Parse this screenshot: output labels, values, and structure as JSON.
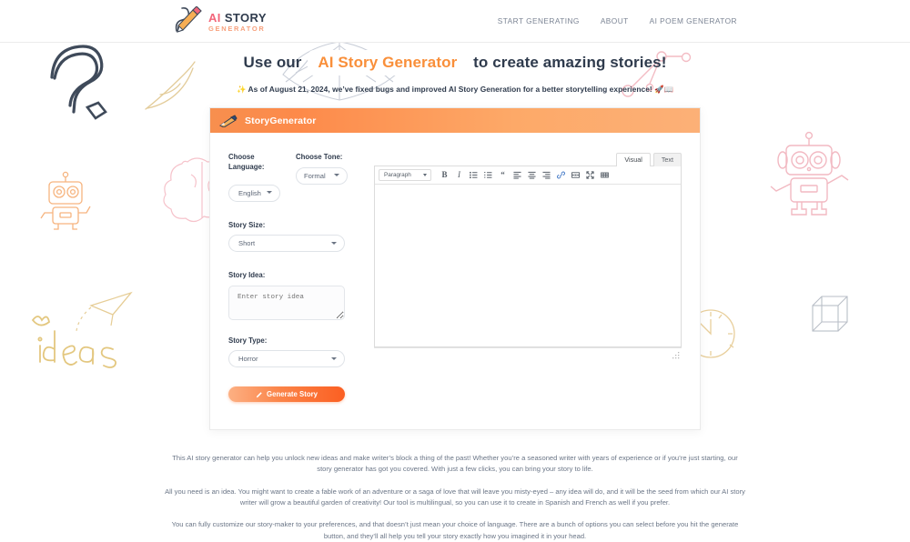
{
  "brand": {
    "logo_icon": "pencil-scribble-icon",
    "line1_ai": "AI",
    "line1_story": "STORY",
    "line2": "GENERATOR"
  },
  "nav": {
    "items": [
      {
        "label": "START GENERATING",
        "name": "nav-start-generating"
      },
      {
        "label": "ABOUT",
        "name": "nav-about"
      },
      {
        "label": "AI POEM GENERATOR",
        "name": "nav-ai-poem-generator"
      }
    ]
  },
  "hero": {
    "title_before": "Use our",
    "title_highlight": "AI Story Generator",
    "title_after": "to create amazing stories!",
    "note_spark": "✨",
    "note_text": "As of August 21, 2024, we’ve fixed bugs and improved AI Story Generation for a better storytelling experience!",
    "note_emoji": "🚀📖"
  },
  "card": {
    "header_icon": "quill-pen-icon",
    "title": "StoryGenerator",
    "form": {
      "language_label": "Choose Language:",
      "language_value": "English",
      "tone_label": "Choose Tone:",
      "tone_value": "Formal",
      "size_label": "Story Size:",
      "size_value": "Short",
      "idea_label": "Story Idea:",
      "idea_value": "",
      "idea_placeholder": "Enter story idea",
      "type_label": "Story Type:",
      "type_value": "Horror",
      "generate_label": "Generate Story",
      "generate_icon": "pencil-icon"
    },
    "editor": {
      "tab_visual": "Visual",
      "tab_text": "Text",
      "format_value": "Paragraph",
      "content": "",
      "toolbar": [
        {
          "name": "bold-icon",
          "glyph": "B"
        },
        {
          "name": "italic-icon",
          "glyph": "I"
        },
        {
          "name": "bulleted-list-icon",
          "glyph": ""
        },
        {
          "name": "numbered-list-icon",
          "glyph": ""
        },
        {
          "name": "blockquote-icon",
          "glyph": "“"
        },
        {
          "name": "align-left-icon",
          "glyph": ""
        },
        {
          "name": "align-center-icon",
          "glyph": ""
        },
        {
          "name": "align-right-icon",
          "glyph": ""
        },
        {
          "name": "insert-link-icon",
          "glyph": ""
        },
        {
          "name": "read-more-icon",
          "glyph": ""
        },
        {
          "name": "fullscreen-icon",
          "glyph": ""
        },
        {
          "name": "toolbar-toggle-icon",
          "glyph": ""
        }
      ]
    }
  },
  "copy": {
    "p1": "This AI story generator can help you unlock new ideas and make writer’s block a thing of the past! Whether you’re a seasoned writer with years of experience or if you’re just starting, our story generator has got you covered. With just a few clicks, you can bring your story to life.",
    "p2": "All you need is an idea. You might want to create a fable work of an adventure or a saga of love that will leave you misty-eyed – any idea will do, and it will be the seed from which our AI story writer will grow a beautiful garden of creativity! Our tool is multilingual, so you can use it to create in Spanish and French as well if you prefer.",
    "p3": "You can fully customize our story-maker to your preferences, and that doesn’t just mean your choice of language. There are a bunch of options you can select before you hit the generate button, and they’ll all help you tell your story exactly how you imagined it in your head."
  },
  "decor": {
    "word_ideas": "ideas",
    "shapes": [
      "question-mark-doodle",
      "ink-drop-doodle",
      "feather-quill-doodle",
      "robot-orange-doodle",
      "robot-pink-doodle",
      "paper-plane-doodle",
      "clock-doodle",
      "wireframe-cube-doodle",
      "open-book-doodle",
      "molecule-doodle",
      "brain-doodle"
    ]
  },
  "colors": {
    "accent_orange": "#f98f3a",
    "brand_pink": "#f2657a",
    "text_dark": "#2f3b4d",
    "text_muted": "#6b7687"
  }
}
